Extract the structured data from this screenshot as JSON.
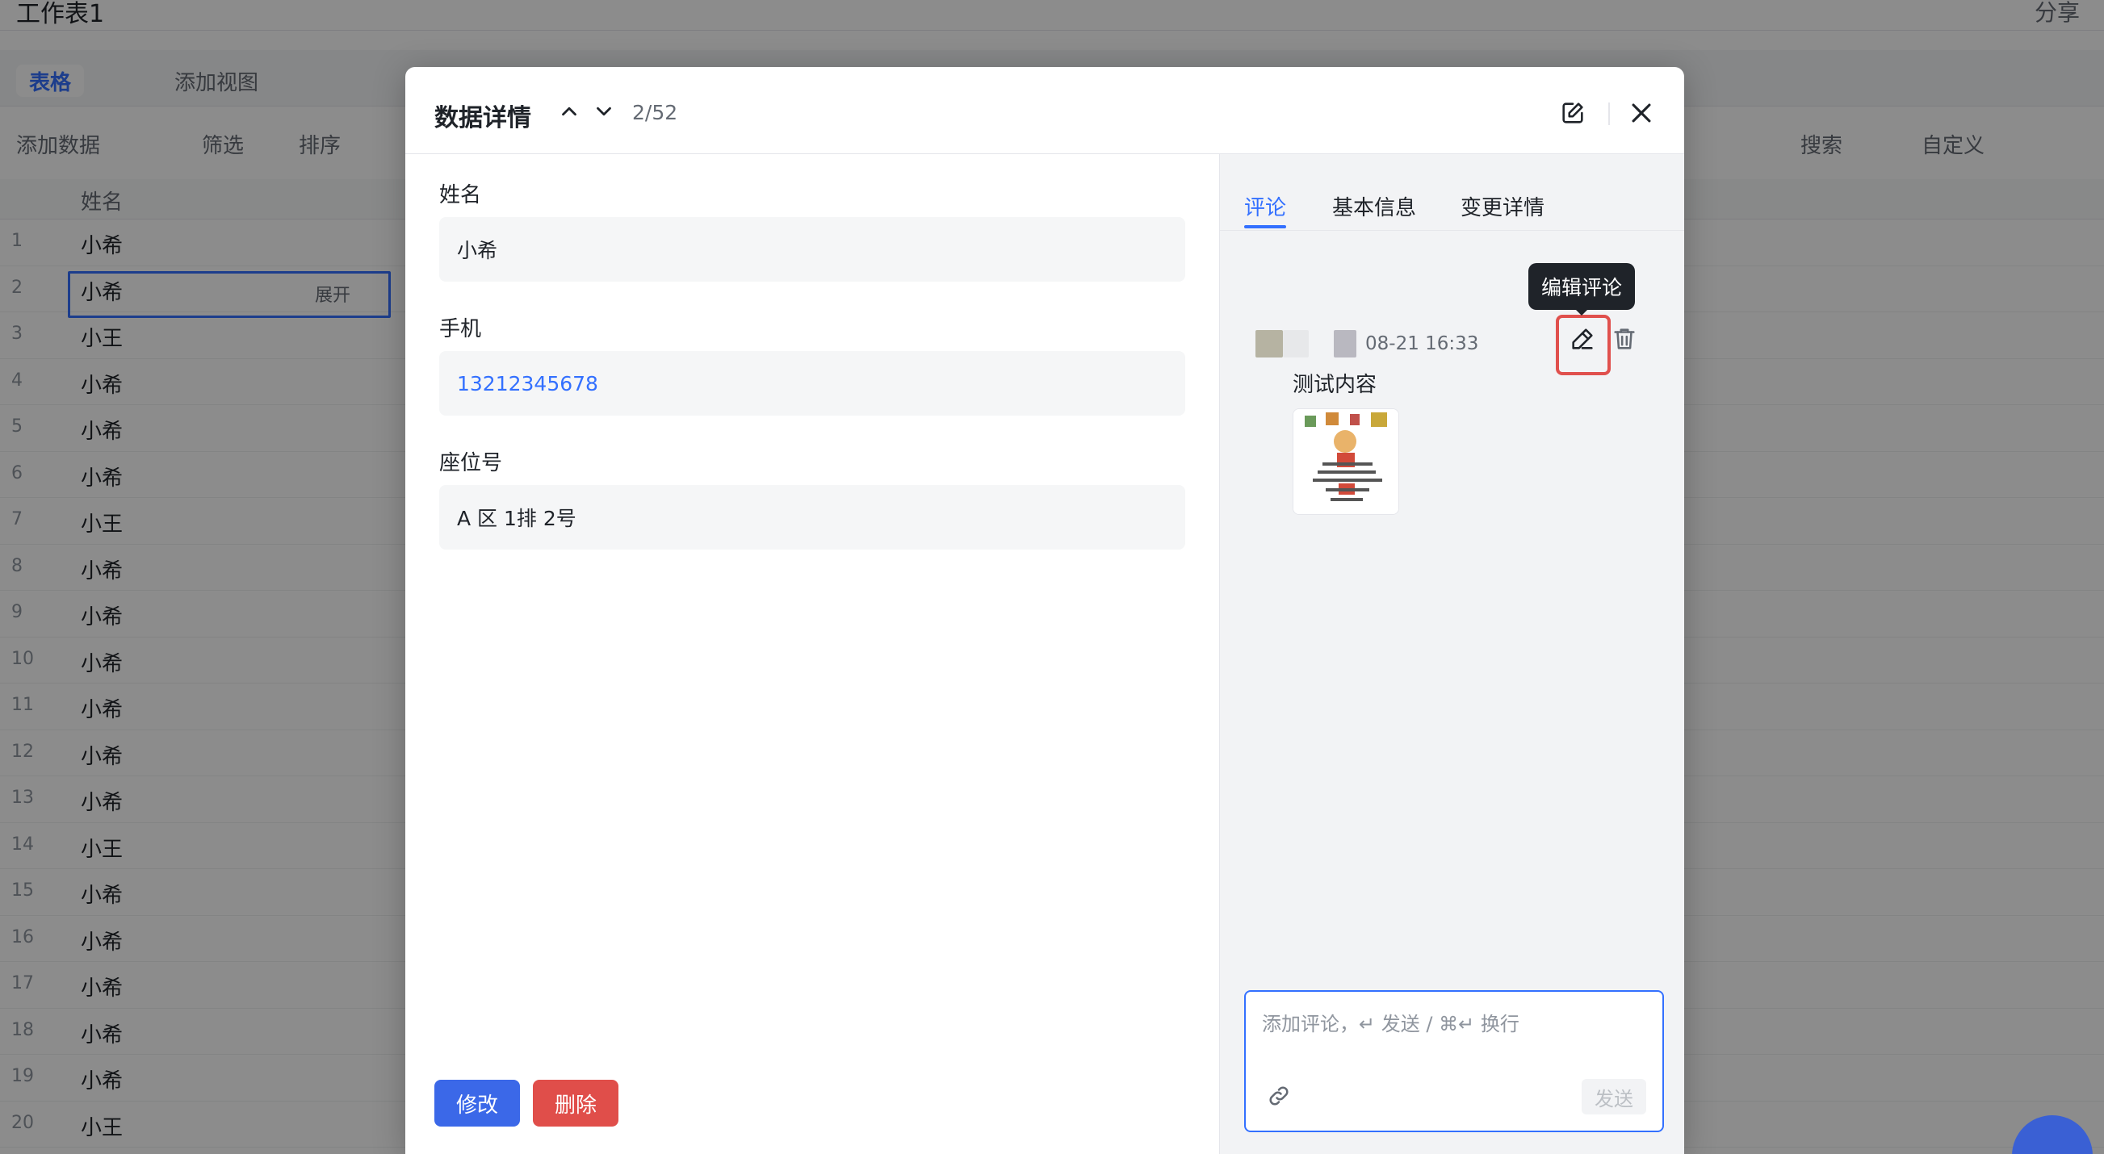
{
  "background": {
    "app_title": "工作表1",
    "top_right": "分享",
    "active_view": "表格",
    "add_view": "添加视图",
    "toolbar": [
      "添加数据",
      "筛选",
      "排序",
      "搜索",
      "自定义"
    ],
    "column_header": "姓名",
    "row_names": [
      "小希",
      "小希",
      "小王",
      "小希",
      "小希",
      "小希",
      "小王",
      "小希",
      "小希",
      "小希",
      "小希",
      "小希",
      "小希",
      "小王",
      "小希",
      "小希",
      "小希",
      "小希",
      "小希",
      "小王"
    ],
    "expand_label": "展开"
  },
  "modal": {
    "title": "数据详情",
    "counter": "2/52",
    "prev_icon": "chevron-up-icon",
    "next_icon": "chevron-down-icon",
    "open_icon": "open-external-icon",
    "close_icon": "close-icon",
    "fields": [
      {
        "label": "姓名",
        "value": "小希"
      },
      {
        "label": "手机",
        "value": "13212345678"
      },
      {
        "label": "座位号",
        "value": "A 区 1排 2号"
      }
    ],
    "edit_button": "修改",
    "delete_button": "删除"
  },
  "side_panel": {
    "tabs": [
      "评论",
      "基本信息",
      "变更详情"
    ],
    "active_tab": "评论",
    "tooltip": "编辑评论",
    "comment": {
      "time": "08-21 16:33",
      "text": "测试内容",
      "edit_icon": "pencil-icon",
      "delete_icon": "trash-icon"
    },
    "composer": {
      "placeholder": "添加评论，↵ 发送 / ⌘↵ 换行",
      "attach_icon": "link-icon",
      "send_label": "发送"
    }
  },
  "colors": {
    "accent": "#3370ff",
    "danger": "#e04e4a",
    "highlight": "#e0504d"
  }
}
